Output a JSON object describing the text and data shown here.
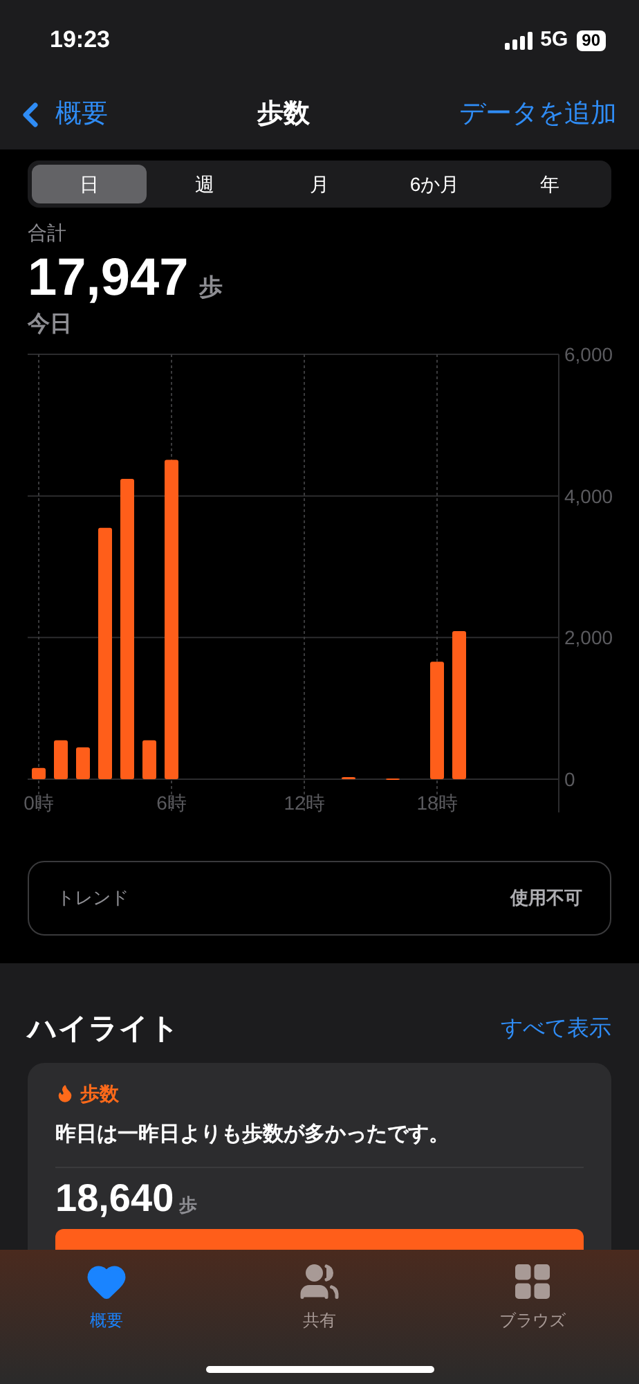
{
  "status_bar": {
    "time": "19:23",
    "network": "5G",
    "battery": "90"
  },
  "nav": {
    "back": "概要",
    "title": "歩数",
    "action": "データを追加"
  },
  "periods": [
    {
      "label": "日",
      "selected": true
    },
    {
      "label": "週",
      "selected": false
    },
    {
      "label": "月",
      "selected": false
    },
    {
      "label": "6か月",
      "selected": false
    },
    {
      "label": "年",
      "selected": false
    }
  ],
  "summary": {
    "label": "合計",
    "value": "17,947",
    "unit": "歩",
    "date": "今日"
  },
  "chart_data": {
    "type": "bar",
    "x": [
      0,
      1,
      2,
      3,
      4,
      5,
      6,
      7,
      8,
      9,
      10,
      11,
      12,
      13,
      14,
      15,
      16,
      17,
      18,
      19,
      20,
      21,
      22,
      23
    ],
    "xlim": [
      -0.5,
      23.5
    ],
    "grid": true,
    "series": [
      {
        "color": "#ff5e1a",
        "values": [
          160,
          550,
          450,
          3550,
          4240,
          550,
          4510,
          0,
          0,
          0,
          0,
          0,
          0,
          0,
          30,
          0,
          10,
          0,
          1660,
          2090,
          0,
          0,
          0,
          0
        ]
      }
    ],
    "ylim": [
      0,
      6000
    ],
    "yticks": [
      {
        "value": 0,
        "label": "0"
      },
      {
        "value": 2000,
        "label": "2,000"
      },
      {
        "value": 4000,
        "label": "4,000"
      },
      {
        "value": 6000,
        "label": "6,000"
      }
    ],
    "xticks": [
      {
        "value": 0,
        "label": "0時"
      },
      {
        "value": 6,
        "label": "6時"
      },
      {
        "value": 12,
        "label": "12時"
      },
      {
        "value": 18,
        "label": "18時"
      }
    ]
  },
  "trend": {
    "label": "トレンド",
    "value": "使用不可"
  },
  "highlights": {
    "title": "ハイライト",
    "link": "すべて表示",
    "card": {
      "category": "歩数",
      "text": "昨日は一昨日よりも歩数が多かったです。",
      "value": "18,640",
      "unit": "歩"
    }
  },
  "tab_bar": [
    {
      "label": "概要",
      "kind": "heart",
      "selected": true
    },
    {
      "label": "共有",
      "kind": "people",
      "selected": false
    },
    {
      "label": "ブラウズ",
      "kind": "grid",
      "selected": false
    }
  ]
}
